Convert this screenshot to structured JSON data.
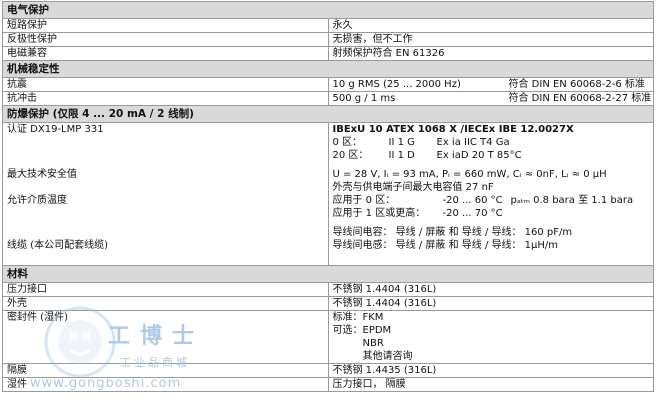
{
  "electrical": {
    "header": "电气保护",
    "rows": [
      {
        "label": "短路保护",
        "value": "永久"
      },
      {
        "label": "反极性保护",
        "value": "无损害，但不工作"
      },
      {
        "label": "电磁兼容",
        "value": "射频保护符合  EN 61326"
      }
    ]
  },
  "mechanical": {
    "header": "机械稳定性",
    "rows": [
      {
        "label": "抗震",
        "value": "10 g RMS (25 ... 2000 Hz)",
        "std": "符合 DIN EN 60068-2-6 标准"
      },
      {
        "label": "抗冲击",
        "value": "500 g / 1 ms",
        "std": "符合 DIN EN 60068-2-27 标准"
      }
    ]
  },
  "explosion": {
    "header": "防爆保护 (仅限 4 ... 20 mA / 2 线制)",
    "cert_label": "认证 DX19-LMP 331",
    "cert_line": "IBExU 10 ATEX 1068 X     /IECEx IBE 12.0027X",
    "zone0_key": "0 区：",
    "zone0_cat": "II 1 G",
    "zone0_marking": "Ex ia IIC T4 Ga",
    "zone20_key": "20 区：",
    "zone20_cat": "II 1 D",
    "zone20_marking": "Ex iaD 20 T 85°C",
    "safety_label": "最大技术安全值",
    "safety_line1": "U  = 28 V, Iᵢ = 93 mA, Pᵢ = 660 mW, Cᵢ ≈ 0nF, Lᵢ ≈ 0 μH",
    "safety_line2": "外壳与供电端子间最大电容值 27 nF",
    "medium_label": "允许介质温度",
    "medium_line1_key": "应用于 0 区：",
    "medium_line1_temp": "-20 ... 60 °C",
    "medium_line1_patm": "pₐₜₘ 0.8 bara  至  1.1 bara",
    "medium_line2_key": "应用于  1 区或更高：",
    "medium_line2_temp": "-20 ... 70 °C",
    "cable_label": "线缆 (本公司配套线缆)",
    "cable_line1": "导线间电容：  导线 / 屏蔽  和  导线 / 导线：   160 pF/m",
    "cable_line2": "导线间电感：  导线 / 屏蔽  和  导线 / 导线：   1μH/m"
  },
  "materials": {
    "header": "材料",
    "pressure_label": "压力接口",
    "pressure_value": "不锈钢  1.4404 (316L)",
    "housing_label": "外壳",
    "housing_value": "不锈钢  1.4404 (316L)",
    "seal_label": "密封件 (湿件)",
    "seal_std": "标准：FKM",
    "seal_opt1": "可选：EPDM",
    "seal_opt2": "NBR",
    "seal_opt3": "其他请咨询",
    "diaphragm_label": "隔膜",
    "diaphragm_value": "不锈钢  1.4435 (316L)",
    "wetted_label": "湿件",
    "wetted_value": "压力接口，  隔膜"
  },
  "watermark": {
    "big": "工博士",
    "sub": "工业品商城",
    "url": "www.gongboshi.com"
  }
}
